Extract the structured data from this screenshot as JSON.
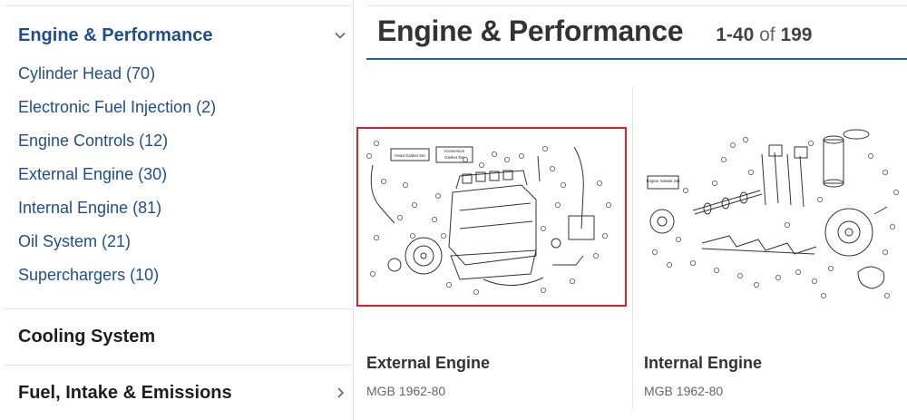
{
  "sidebar": {
    "active_section": "Engine & Performance",
    "items": [
      {
        "label": "Cylinder Head (70)"
      },
      {
        "label": "Electronic Fuel Injection (2)"
      },
      {
        "label": "Engine Controls (12)"
      },
      {
        "label": "External Engine (30)"
      },
      {
        "label": "Internal Engine (81)"
      },
      {
        "label": "Oil System (21)"
      },
      {
        "label": "Superchargers (10)"
      }
    ],
    "section_cooling": "Cooling System",
    "section_fuel": "Fuel, Intake & Emissions"
  },
  "main": {
    "title": "Engine & Performance",
    "range": "1-40",
    "of": "of",
    "total": "199",
    "cards": [
      {
        "title": "External Engine",
        "subtitle": "MGB 1962-80",
        "diagram_labels": [
          "Head Gasket Set",
          "Conversion Gasket Set"
        ]
      },
      {
        "title": "Internal Engine",
        "subtitle": "MGB 1962-80",
        "diagram_labels": [
          "Engine Gasket Set"
        ]
      }
    ]
  },
  "colors": {
    "link": "#1f4e8c",
    "accent_rule": "#2a5d9f",
    "selected_border": "#d4202f"
  }
}
